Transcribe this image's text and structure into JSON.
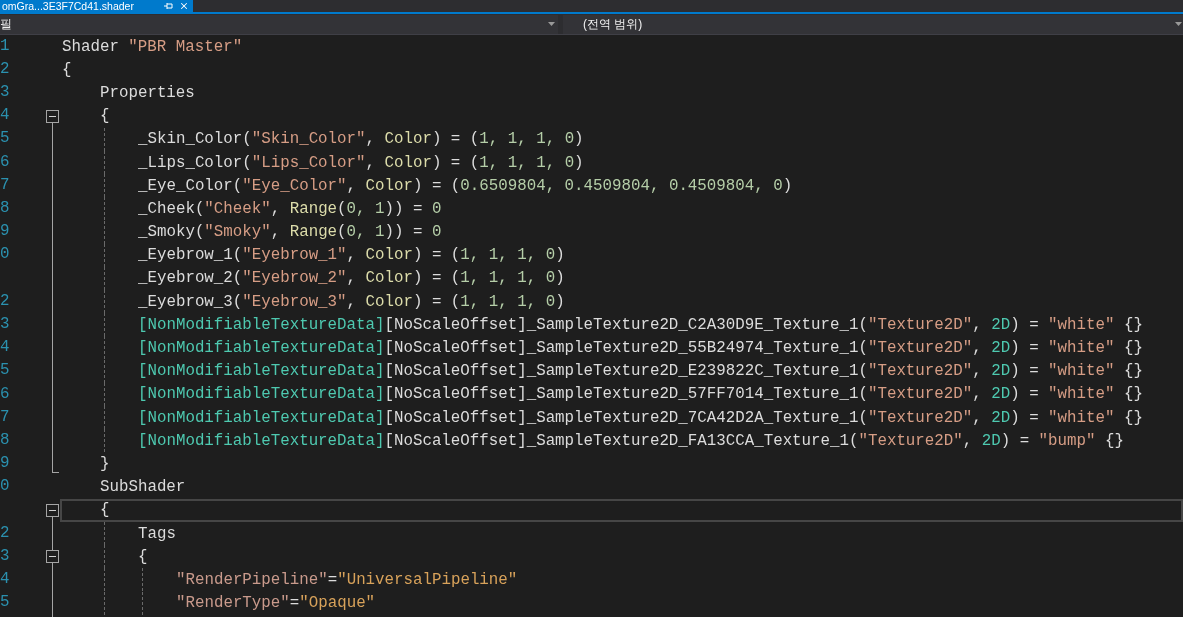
{
  "tab": {
    "title": "omGra...3E3F7Cd41.shader",
    "selected": true
  },
  "navigation_bar": {
    "left_dropdown": {
      "value": "필"
    },
    "right_dropdown": {
      "value": "(전역 범위)"
    }
  },
  "editor": {
    "lines": [
      {
        "number": "1",
        "current": false,
        "tokens": [
          {
            "kind": "plain",
            "text": "Shader "
          },
          {
            "kind": "string",
            "text": "\"PBR Master\""
          }
        ]
      },
      {
        "number": "2",
        "current": false,
        "tokens": [
          {
            "kind": "plain",
            "text": "{"
          }
        ],
        "children": [
          {
            "number": "3",
            "current": false,
            "tokens": [
              {
                "kind": "plain",
                "text": "Properties"
              }
            ]
          },
          {
            "number": "4",
            "current": false,
            "expanded": true,
            "tokens": [
              {
                "kind": "plain",
                "text": "{"
              }
            ],
            "children": [
              {
                "number": "5",
                "current": false,
                "tokens": [
                  {
                    "kind": "plain",
                    "text": "_Skin_Color("
                  },
                  {
                    "kind": "string",
                    "text": "\"Skin_Color\""
                  },
                  {
                    "kind": "plain",
                    "text": ", "
                  },
                  {
                    "kind": "type",
                    "text": "Color"
                  },
                  {
                    "kind": "plain",
                    "text": ") = ("
                  },
                  {
                    "kind": "number",
                    "text": "1, 1, 1, 0"
                  },
                  {
                    "kind": "plain",
                    "text": ")"
                  }
                ]
              },
              {
                "number": "6",
                "current": false,
                "tokens": [
                  {
                    "kind": "plain",
                    "text": "_Lips_Color("
                  },
                  {
                    "kind": "string",
                    "text": "\"Lips_Color\""
                  },
                  {
                    "kind": "plain",
                    "text": ", "
                  },
                  {
                    "kind": "type",
                    "text": "Color"
                  },
                  {
                    "kind": "plain",
                    "text": ") = ("
                  },
                  {
                    "kind": "number",
                    "text": "1, 1, 1, 0"
                  },
                  {
                    "kind": "plain",
                    "text": ")"
                  }
                ]
              },
              {
                "number": "7",
                "current": false,
                "tokens": [
                  {
                    "kind": "plain",
                    "text": "_Eye_Color("
                  },
                  {
                    "kind": "string",
                    "text": "\"Eye_Color\""
                  },
                  {
                    "kind": "plain",
                    "text": ", "
                  },
                  {
                    "kind": "type",
                    "text": "Color"
                  },
                  {
                    "kind": "plain",
                    "text": ") = ("
                  },
                  {
                    "kind": "number",
                    "text": "0.6509804, 0.4509804, 0.4509804, 0"
                  },
                  {
                    "kind": "plain",
                    "text": ")"
                  }
                ]
              },
              {
                "number": "8",
                "current": false,
                "tokens": [
                  {
                    "kind": "plain",
                    "text": "_Cheek("
                  },
                  {
                    "kind": "string",
                    "text": "\"Cheek\""
                  },
                  {
                    "kind": "plain",
                    "text": ", "
                  },
                  {
                    "kind": "type",
                    "text": "Range"
                  },
                  {
                    "kind": "plain",
                    "text": "("
                  },
                  {
                    "kind": "number",
                    "text": "0, 1"
                  },
                  {
                    "kind": "plain",
                    "text": ")) = "
                  },
                  {
                    "kind": "number",
                    "text": "0"
                  }
                ]
              },
              {
                "number": "9",
                "current": false,
                "tokens": [
                  {
                    "kind": "plain",
                    "text": "_Smoky("
                  },
                  {
                    "kind": "string",
                    "text": "\"Smoky\""
                  },
                  {
                    "kind": "plain",
                    "text": ", "
                  },
                  {
                    "kind": "type",
                    "text": "Range"
                  },
                  {
                    "kind": "plain",
                    "text": "("
                  },
                  {
                    "kind": "number",
                    "text": "0, 1"
                  },
                  {
                    "kind": "plain",
                    "text": ")) = "
                  },
                  {
                    "kind": "number",
                    "text": "0"
                  }
                ]
              },
              {
                "number": "0",
                "current": false,
                "tokens": [
                  {
                    "kind": "plain",
                    "text": "_Eyebrow_1("
                  },
                  {
                    "kind": "string",
                    "text": "\"Eyebrow_1\""
                  },
                  {
                    "kind": "plain",
                    "text": ", "
                  },
                  {
                    "kind": "type",
                    "text": "Color"
                  },
                  {
                    "kind": "plain",
                    "text": ") = ("
                  },
                  {
                    "kind": "number",
                    "text": "1, 1, 1, 0"
                  },
                  {
                    "kind": "plain",
                    "text": ")"
                  }
                ]
              },
              {
                "current": false,
                "tokens": [
                  {
                    "kind": "plain",
                    "text": "_Eyebrow_2("
                  },
                  {
                    "kind": "string",
                    "text": "\"Eyebrow_2\""
                  },
                  {
                    "kind": "plain",
                    "text": ", "
                  },
                  {
                    "kind": "type",
                    "text": "Color"
                  },
                  {
                    "kind": "plain",
                    "text": ") = ("
                  },
                  {
                    "kind": "number",
                    "text": "1, 1, 1, 0"
                  },
                  {
                    "kind": "plain",
                    "text": ")"
                  }
                ]
              },
              {
                "number": "2",
                "current": false,
                "tokens": [
                  {
                    "kind": "plain",
                    "text": "_Eyebrow_3("
                  },
                  {
                    "kind": "string",
                    "text": "\"Eyebrow_3\""
                  },
                  {
                    "kind": "plain",
                    "text": ", "
                  },
                  {
                    "kind": "type",
                    "text": "Color"
                  },
                  {
                    "kind": "plain",
                    "text": ") = ("
                  },
                  {
                    "kind": "number",
                    "text": "1, 1, 1, 0"
                  },
                  {
                    "kind": "plain",
                    "text": ")"
                  }
                ]
              },
              {
                "number": "3",
                "current": false,
                "tokens": [
                  {
                    "kind": "attribute",
                    "text": "[NonModifiableTextureData]"
                  },
                  {
                    "kind": "plain",
                    "text": "[NoScaleOffset]_SampleTexture2D_C2A30D9E_Texture_1("
                  },
                  {
                    "kind": "string",
                    "text": "\"Texture2D\""
                  },
                  {
                    "kind": "plain",
                    "text": ", "
                  },
                  {
                    "kind": "attribute",
                    "text": "2D"
                  },
                  {
                    "kind": "plain",
                    "text": ") = "
                  },
                  {
                    "kind": "string",
                    "text": "\"white\""
                  },
                  {
                    "kind": "plain",
                    "text": " {}"
                  }
                ]
              },
              {
                "number": "4",
                "current": false,
                "tokens": [
                  {
                    "kind": "attribute",
                    "text": "[NonModifiableTextureData]"
                  },
                  {
                    "kind": "plain",
                    "text": "[NoScaleOffset]_SampleTexture2D_55B24974_Texture_1("
                  },
                  {
                    "kind": "string",
                    "text": "\"Texture2D\""
                  },
                  {
                    "kind": "plain",
                    "text": ", "
                  },
                  {
                    "kind": "attribute",
                    "text": "2D"
                  },
                  {
                    "kind": "plain",
                    "text": ") = "
                  },
                  {
                    "kind": "string",
                    "text": "\"white\""
                  },
                  {
                    "kind": "plain",
                    "text": " {}"
                  }
                ]
              },
              {
                "number": "5",
                "current": false,
                "tokens": [
                  {
                    "kind": "attribute",
                    "text": "[NonModifiableTextureData]"
                  },
                  {
                    "kind": "plain",
                    "text": "[NoScaleOffset]_SampleTexture2D_E239822C_Texture_1("
                  },
                  {
                    "kind": "string",
                    "text": "\"Texture2D\""
                  },
                  {
                    "kind": "plain",
                    "text": ", "
                  },
                  {
                    "kind": "attribute",
                    "text": "2D"
                  },
                  {
                    "kind": "plain",
                    "text": ") = "
                  },
                  {
                    "kind": "string",
                    "text": "\"white\""
                  },
                  {
                    "kind": "plain",
                    "text": " {}"
                  }
                ]
              },
              {
                "number": "6",
                "current": false,
                "tokens": [
                  {
                    "kind": "attribute",
                    "text": "[NonModifiableTextureData]"
                  },
                  {
                    "kind": "plain",
                    "text": "[NoScaleOffset]_SampleTexture2D_57FF7014_Texture_1("
                  },
                  {
                    "kind": "string",
                    "text": "\"Texture2D\""
                  },
                  {
                    "kind": "plain",
                    "text": ", "
                  },
                  {
                    "kind": "attribute",
                    "text": "2D"
                  },
                  {
                    "kind": "plain",
                    "text": ") = "
                  },
                  {
                    "kind": "string",
                    "text": "\"white\""
                  },
                  {
                    "kind": "plain",
                    "text": " {}"
                  }
                ]
              },
              {
                "number": "7",
                "current": false,
                "tokens": [
                  {
                    "kind": "attribute",
                    "text": "[NonModifiableTextureData]"
                  },
                  {
                    "kind": "plain",
                    "text": "[NoScaleOffset]_SampleTexture2D_7CA42D2A_Texture_1("
                  },
                  {
                    "kind": "string",
                    "text": "\"Texture2D\""
                  },
                  {
                    "kind": "plain",
                    "text": ", "
                  },
                  {
                    "kind": "attribute",
                    "text": "2D"
                  },
                  {
                    "kind": "plain",
                    "text": ") = "
                  },
                  {
                    "kind": "string",
                    "text": "\"white\""
                  },
                  {
                    "kind": "plain",
                    "text": " {}"
                  }
                ]
              },
              {
                "number": "8",
                "current": false,
                "tokens": [
                  {
                    "kind": "attribute",
                    "text": "[NonModifiableTextureData]"
                  },
                  {
                    "kind": "plain",
                    "text": "[NoScaleOffset]_SampleTexture2D_FA13CCA_Texture_1("
                  },
                  {
                    "kind": "string",
                    "text": "\"Texture2D\""
                  },
                  {
                    "kind": "plain",
                    "text": ", "
                  },
                  {
                    "kind": "attribute",
                    "text": "2D"
                  },
                  {
                    "kind": "plain",
                    "text": ") = "
                  },
                  {
                    "kind": "string",
                    "text": "\"bump\""
                  },
                  {
                    "kind": "plain",
                    "text": " {}"
                  }
                ]
              }
            ]
          },
          {
            "number": "9",
            "current": false,
            "tokens": [
              {
                "kind": "plain",
                "text": "}"
              }
            ]
          },
          {
            "number": "0",
            "current": false,
            "tokens": [
              {
                "kind": "plain",
                "text": "SubShader"
              }
            ]
          },
          {
            "current": true,
            "expanded": true,
            "tokens": [
              {
                "kind": "plain",
                "text": "{"
              }
            ],
            "children": [
              {
                "number": "2",
                "current": false,
                "tokens": [
                  {
                    "kind": "plain",
                    "text": "Tags"
                  }
                ]
              },
              {
                "number": "3",
                "current": false,
                "expanded": true,
                "tokens": [
                  {
                    "kind": "plain",
                    "text": "{"
                  }
                ],
                "children": [
                  {
                    "number": "4",
                    "current": false,
                    "tokens": [
                      {
                        "kind": "tag_key",
                        "text": "\"RenderPipeline\""
                      },
                      {
                        "kind": "plain",
                        "text": "="
                      },
                      {
                        "kind": "tag_value",
                        "text": "\"UniversalPipeline\""
                      }
                    ]
                  },
                  {
                    "number": "5",
                    "current": false,
                    "tokens": [
                      {
                        "kind": "tag_key",
                        "text": "\"RenderType\""
                      },
                      {
                        "kind": "plain",
                        "text": "="
                      },
                      {
                        "kind": "tag_value",
                        "text": "\"Opaque\""
                      }
                    ]
                  }
                ]
              }
            ]
          }
        ]
      }
    ]
  }
}
